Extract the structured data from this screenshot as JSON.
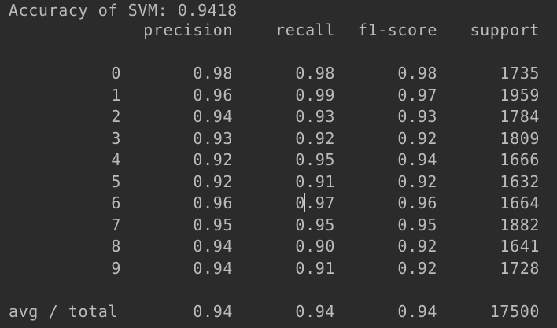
{
  "output": {
    "accuracy_line": "Accuracy of SVM: 0.9418",
    "headers": [
      "precision",
      "recall",
      "f1-score",
      "support"
    ],
    "rows": [
      {
        "label": "0",
        "precision": "0.98",
        "recall": "0.98",
        "f1": "0.98",
        "support": "1735"
      },
      {
        "label": "1",
        "precision": "0.96",
        "recall": "0.99",
        "f1": "0.97",
        "support": "1959"
      },
      {
        "label": "2",
        "precision": "0.94",
        "recall": "0.93",
        "f1": "0.93",
        "support": "1784"
      },
      {
        "label": "3",
        "precision": "0.93",
        "recall": "0.92",
        "f1": "0.92",
        "support": "1809"
      },
      {
        "label": "4",
        "precision": "0.92",
        "recall": "0.95",
        "f1": "0.94",
        "support": "1666"
      },
      {
        "label": "5",
        "precision": "0.92",
        "recall": "0.91",
        "f1": "0.92",
        "support": "1632"
      },
      {
        "label": "6",
        "precision": "0.96",
        "recall": "0.97",
        "f1": "0.96",
        "support": "1664"
      },
      {
        "label": "7",
        "precision": "0.95",
        "recall": "0.95",
        "f1": "0.95",
        "support": "1882"
      },
      {
        "label": "8",
        "precision": "0.94",
        "recall": "0.90",
        "f1": "0.92",
        "support": "1641"
      },
      {
        "label": "9",
        "precision": "0.94",
        "recall": "0.91",
        "f1": "0.92",
        "support": "1728"
      }
    ],
    "total": {
      "label": "avg / total",
      "precision": "0.94",
      "recall": "0.94",
      "f1": "0.94",
      "support": "17500"
    }
  }
}
